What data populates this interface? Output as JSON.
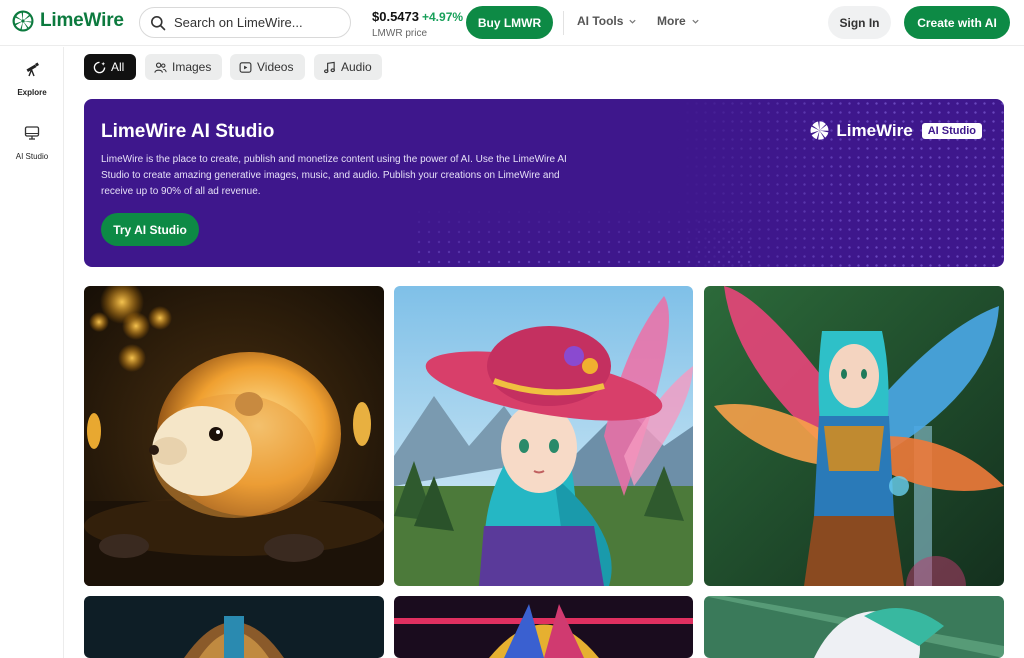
{
  "header": {
    "logo_text": "LimeWire",
    "search_placeholder": "Search on LimeWire...",
    "price_value": "$0.5473",
    "price_change": "+4.97%",
    "price_label": "LMWR price",
    "buy_label": "Buy LMWR",
    "nav_ai_tools": "AI Tools",
    "nav_more": "More",
    "signin_label": "Sign In",
    "create_label": "Create with AI"
  },
  "sidebar": {
    "items": [
      {
        "label": "Explore",
        "icon": "telescope-icon"
      },
      {
        "label": "AI Studio",
        "icon": "monitor-icon"
      }
    ]
  },
  "filters": {
    "all": "All",
    "images": "Images",
    "videos": "Videos",
    "audio": "Audio"
  },
  "banner": {
    "title": "LimeWire AI Studio",
    "description": "LimeWire is the place to create, publish and monetize content using the power of AI. Use the LimeWire AI Studio to create amazing generative images, music, and audio. Publish your creations on LimeWire and receive up to 90% of all ad revenue.",
    "cta": "Try AI Studio",
    "brand_name": "LimeWire",
    "brand_tag": "AI Studio"
  },
  "colors": {
    "brand_green": "#0d8a45",
    "banner_purple": "#3e178c",
    "positive_change": "#18a05a"
  }
}
